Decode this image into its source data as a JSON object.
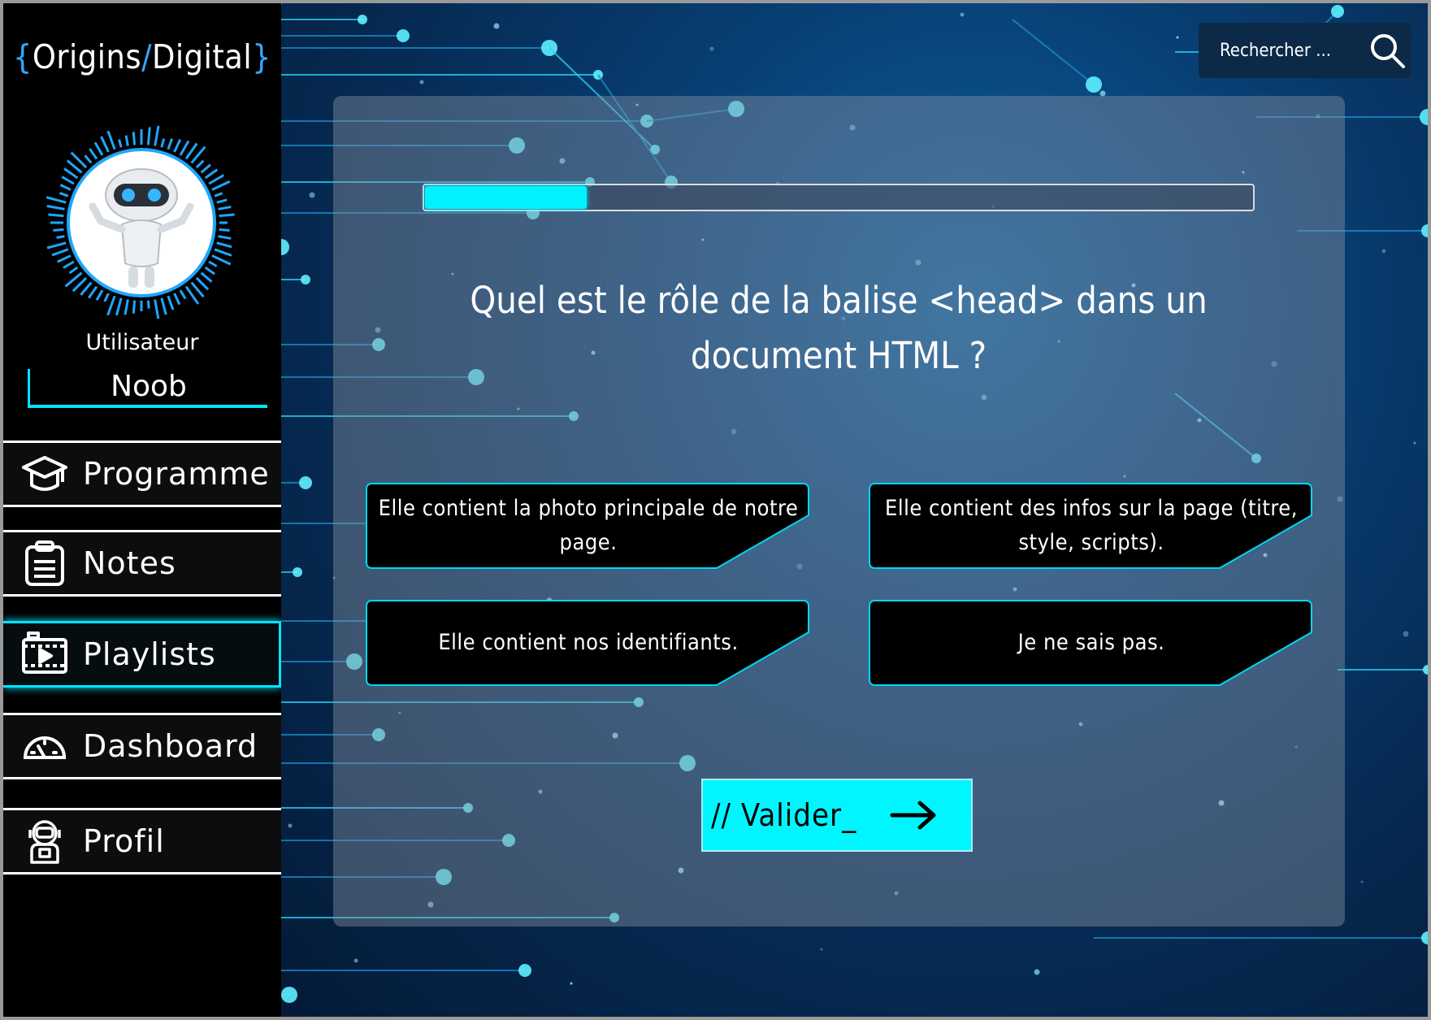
{
  "app": {
    "logo": {
      "open": "{",
      "part1": "Origins",
      "slash": "/",
      "part2": "Digital",
      "close": "}"
    }
  },
  "user": {
    "role": "Utilisateur",
    "name": "Noob"
  },
  "sidebar": {
    "items": [
      {
        "label": "Programme",
        "icon": "graduation-cap-icon"
      },
      {
        "label": "Notes",
        "icon": "clipboard-icon"
      },
      {
        "label": "Playlists",
        "icon": "video-playlist-icon",
        "active": true
      },
      {
        "label": "Dashboard",
        "icon": "speedometer-icon"
      },
      {
        "label": "Profil",
        "icon": "astronaut-icon"
      }
    ]
  },
  "search": {
    "placeholder": "Rechercher ..."
  },
  "quiz": {
    "progress": 0.195,
    "question": "Quel est le rôle de la balise <head> dans un document HTML ?",
    "answers": [
      "Elle contient la photo principale de notre page.",
      "Elle contient des infos sur la page (titre, style, scripts).",
      "Elle contient nos identifiants.",
      "Je ne sais pas."
    ],
    "validate_label": "// Valider_"
  },
  "colors": {
    "accent": "#00e5ff",
    "button": "#00f6ff",
    "logo_accent": "#2fa8ff"
  }
}
